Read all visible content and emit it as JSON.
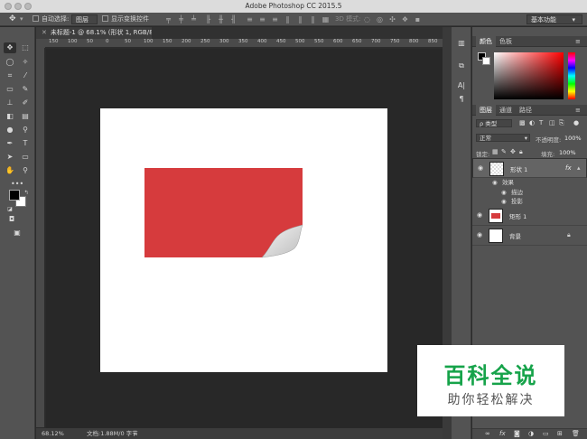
{
  "app": {
    "title": "Adobe Photoshop CC 2015.5"
  },
  "options_bar": {
    "auto_select_label": "自动选择:",
    "auto_select_value": "图层",
    "show_transform_label": "显示变换控件",
    "mode_3d_label": "3D 模式:",
    "workspace_value": "基本功能"
  },
  "document": {
    "tab_title": "未标题-1 @ 68.1% (形状 1, RGB/8) *",
    "fill_color": "#d63b3d",
    "ruler_labels": [
      "150",
      "100",
      "50",
      "0",
      "50",
      "100",
      "150",
      "200",
      "250",
      "300",
      "350",
      "400",
      "450",
      "500",
      "550",
      "600",
      "650",
      "700",
      "750",
      "800",
      "850"
    ]
  },
  "status_bar": {
    "zoom": "68.12%",
    "doc_info": "文档:1.88M/0 字节"
  },
  "color_panel": {
    "tabs": [
      "颜色",
      "色板"
    ],
    "hue_color": "#ff0000"
  },
  "layers_panel": {
    "tabs": [
      "图层",
      "通道",
      "路径"
    ],
    "filter_label": "ρ 类型",
    "blend_mode": "正常",
    "opacity_label": "不透明度:",
    "opacity_value": "100%",
    "lock_label": "锁定:",
    "fill_label": "填充:",
    "fill_value": "100%",
    "layers": [
      {
        "name": "形状 1",
        "fx": "fx",
        "selected": true
      },
      {
        "name": "矩形 1",
        "selected": false
      },
      {
        "name": "背景",
        "selected": false
      }
    ],
    "effects_label": "效果",
    "effects": [
      "描边",
      "投影"
    ]
  },
  "watermark": {
    "line1": "百科全说",
    "line2": "助你轻松解决",
    "color": "#16a34a"
  }
}
